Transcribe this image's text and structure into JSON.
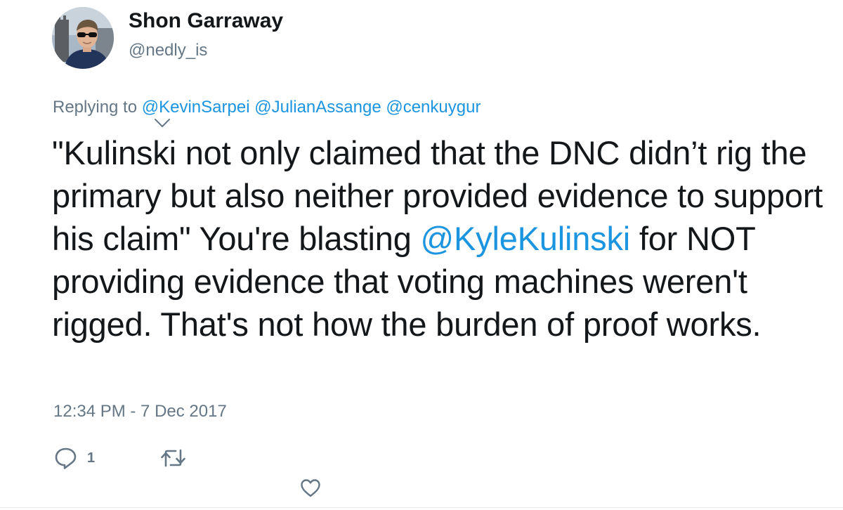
{
  "user": {
    "display_name": "Shon Garraway",
    "handle": "@nedly_is",
    "avatar_icon": "user-avatar-photo"
  },
  "reply": {
    "prefix": "Replying to",
    "mentions": [
      "@KevinSarpei",
      "@JulianAssange",
      "@cenkuygur"
    ]
  },
  "tweet": {
    "text_part1": "\"Kulinski not only claimed that the DNC didn’t rig the primary but also neither provided evidence to support his claim\" You're blasting ",
    "mention": "@KyleKulinski",
    "text_part2": " for NOT providing evidence that voting machines weren't rigged. That's not how the burden of proof works.",
    "timestamp": "12:34 PM - 7 Dec 2017"
  },
  "actions": {
    "reply_icon": "reply-icon",
    "reply_count": "1",
    "retweet_icon": "retweet-icon",
    "like_icon": "heart-icon"
  },
  "colors": {
    "link": "#1b95e0",
    "secondary_text": "#657786",
    "primary_text": "#14171a"
  }
}
